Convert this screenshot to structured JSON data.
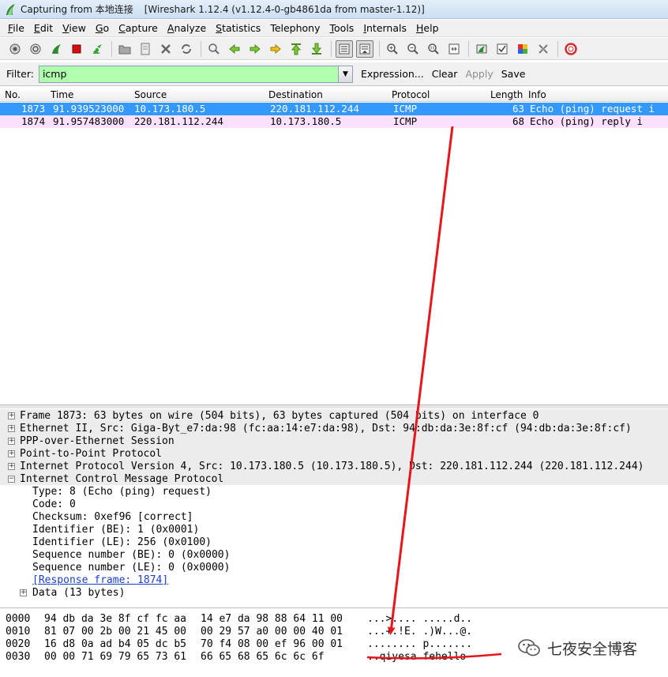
{
  "window": {
    "title_left": "Capturing from 本地连接",
    "title_right": "[Wireshark 1.12.4  (v1.12.4-0-gb4861da from master-1.12)]"
  },
  "menu": [
    {
      "u": "F",
      "rest": "ile"
    },
    {
      "u": "E",
      "rest": "dit"
    },
    {
      "u": "V",
      "rest": "iew"
    },
    {
      "u": "G",
      "rest": "o"
    },
    {
      "u": "C",
      "rest": "apture"
    },
    {
      "u": "A",
      "rest": "nalyze"
    },
    {
      "u": "S",
      "rest": "tatistics"
    },
    {
      "u": "",
      "rest": "Telephony"
    },
    {
      "u": "T",
      "rest": "ools"
    },
    {
      "u": "I",
      "rest": "nternals"
    },
    {
      "u": "H",
      "rest": "elp"
    }
  ],
  "filter": {
    "label": "Filter:",
    "value": "icmp",
    "expression": "Expression...",
    "clear": "Clear",
    "apply": "Apply",
    "save": "Save"
  },
  "packet_list": {
    "columns": [
      "No.",
      "Time",
      "Source",
      "Destination",
      "Protocol",
      "Length",
      "Info"
    ],
    "rows": [
      {
        "no": "1873",
        "time": "91.939523000",
        "src": "10.173.180.5",
        "dst": "220.181.112.244",
        "proto": "ICMP",
        "len": "63",
        "info": "Echo (ping) request  i"
      },
      {
        "no": "1874",
        "time": "91.957483000",
        "src": "220.181.112.244",
        "dst": "10.173.180.5",
        "proto": "ICMP",
        "len": "68",
        "info": "Echo (ping) reply    i"
      }
    ]
  },
  "details": {
    "frame": "Frame 1873: 63 bytes on wire (504 bits), 63 bytes captured (504 bits) on interface 0",
    "ethernet": "Ethernet II, Src: Giga-Byt_e7:da:98 (fc:aa:14:e7:da:98), Dst: 94:db:da:3e:8f:cf (94:db:da:3e:8f:cf)",
    "pppoe": "PPP-over-Ethernet Session",
    "ppp": "Point-to-Point Protocol",
    "ip": "Internet Protocol Version 4, Src: 10.173.180.5 (10.173.180.5), Dst: 220.181.112.244 (220.181.112.244)",
    "icmp": "Internet Control Message Protocol",
    "icmp_fields": [
      "Type: 8 (Echo (ping) request)",
      "Code: 0",
      "Checksum: 0xef96 [correct]",
      "Identifier (BE): 1 (0x0001)",
      "Identifier (LE): 256 (0x0100)",
      "Sequence number (BE): 0 (0x0000)",
      "Sequence number (LE): 0 (0x0000)"
    ],
    "response_link": "[Response frame: 1874]",
    "data": "Data (13 bytes)"
  },
  "bytes": [
    {
      "off": "0000",
      "hex1": "94 db da 3e 8f cf fc aa",
      "hex2": "14 e7 da 98 88 64 11 00",
      "ascii": "...>.... .....d.."
    },
    {
      "off": "0010",
      "hex1": "81 07 00 2b 00 21 45 00",
      "hex2": "00 29 57 a0 00 00 40 01",
      "ascii": "...+.!E. .)W...@."
    },
    {
      "off": "0020",
      "hex1": "16 d8 0a ad b4 05 dc b5",
      "hex2": "70 f4 08 00 ef 96 00 01",
      "ascii": "........ p......."
    },
    {
      "off": "0030",
      "hex1": "00 00 71 69 79 65 73 61",
      "hex2": "66 65 68 65 6c 6c 6f",
      "ascii": "..qiyesa fehello"
    }
  ],
  "watermark": {
    "text": "七夜安全博客"
  },
  "colors": {
    "selected_row": "#3399ff",
    "icmp_row": "#fce0ff",
    "filter_ok": "#afffaf",
    "annotation_red": "#e8161b"
  },
  "icons": {
    "toolbar": [
      "interfaces-icon",
      "options-icon",
      "start-capture-icon",
      "stop-capture-icon",
      "restart-capture-icon",
      "open-file-icon",
      "save-file-icon",
      "close-file-icon",
      "reload-icon",
      "find-icon",
      "go-back-icon",
      "go-forward-icon",
      "go-to-packet-icon",
      "go-first-icon",
      "go-last-icon",
      "colorize-icon",
      "auto-scroll-icon",
      "zoom-in-icon",
      "zoom-out-icon",
      "zoom-normal-icon",
      "resize-columns-icon",
      "capture-filters-icon",
      "display-filters-icon",
      "coloring-rules-icon",
      "preferences-icon",
      "help-icon"
    ]
  }
}
